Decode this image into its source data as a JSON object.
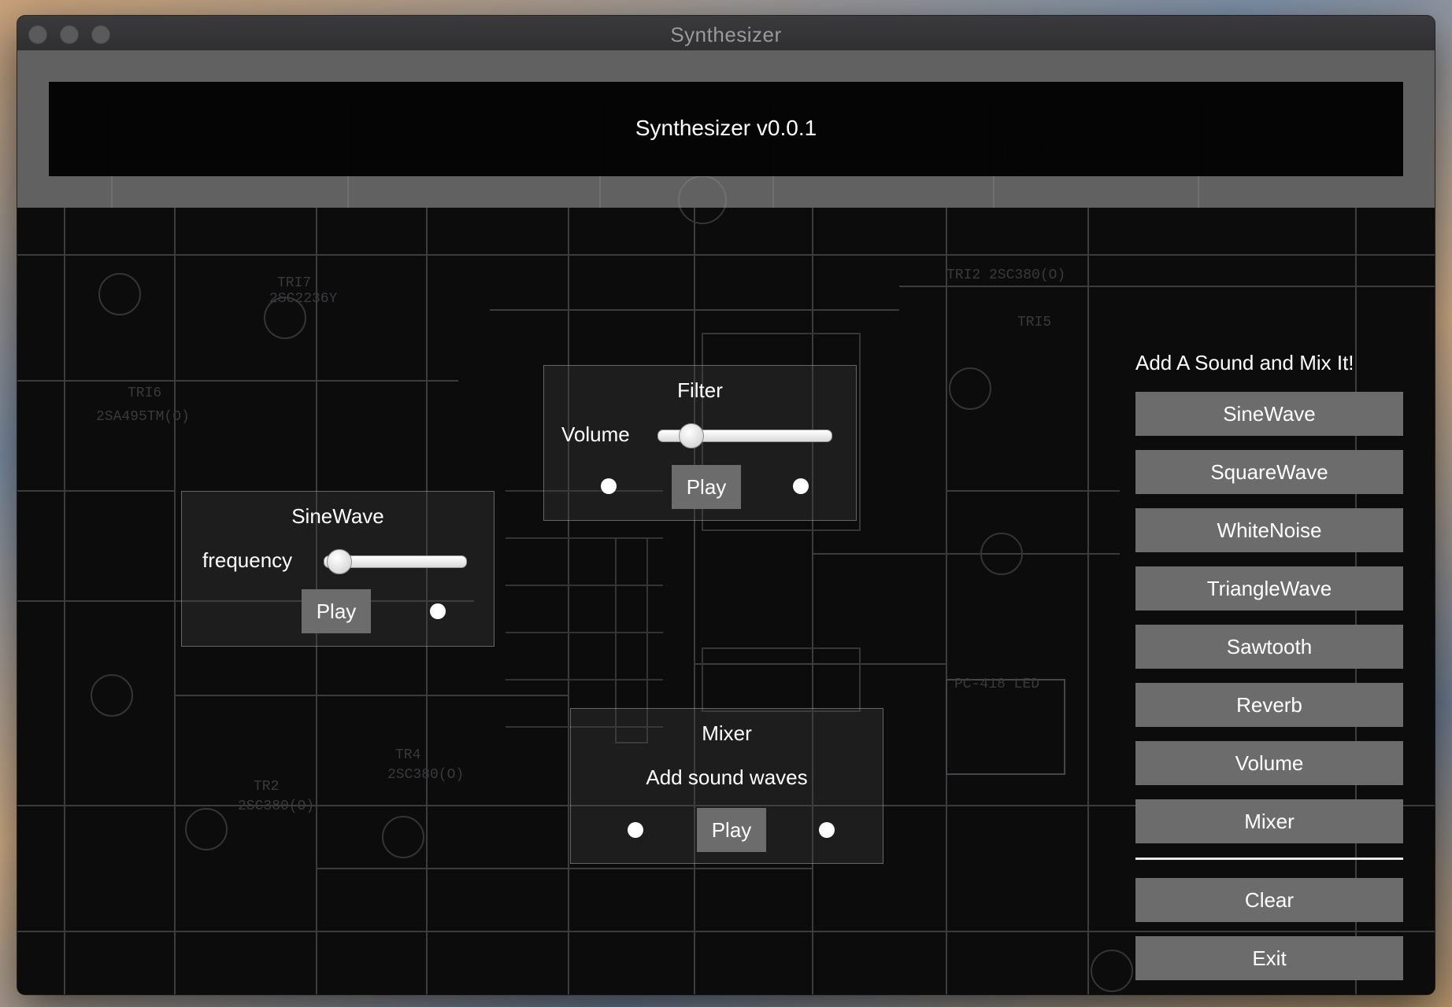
{
  "window": {
    "title": "Synthesizer"
  },
  "header": {
    "title": "Synthesizer v0.0.1"
  },
  "panels": {
    "sinewave": {
      "title": "SineWave",
      "label": "frequency",
      "slider_value": 0.1,
      "play": "Play"
    },
    "filter": {
      "title": "Filter",
      "label": "Volume",
      "slider_value": 0.15,
      "play": "Play"
    },
    "mixer": {
      "title": "Mixer",
      "subtitle": "Add sound waves",
      "play": "Play"
    }
  },
  "sidebar": {
    "heading": "Add A Sound and Mix It!",
    "buttons": [
      "SineWave",
      "SquareWave",
      "WhiteNoise",
      "TriangleWave",
      "Sawtooth",
      "Reverb",
      "Volume",
      "Mixer"
    ],
    "actions": [
      "Clear",
      "Exit"
    ]
  },
  "colors": {
    "button": "#6c6c6c",
    "background": "#0b0b0c",
    "header_band": "#969696"
  },
  "icons": {
    "close": "traffic-light-close-icon",
    "minimize": "traffic-light-minimize-icon",
    "zoom": "traffic-light-zoom-icon"
  }
}
